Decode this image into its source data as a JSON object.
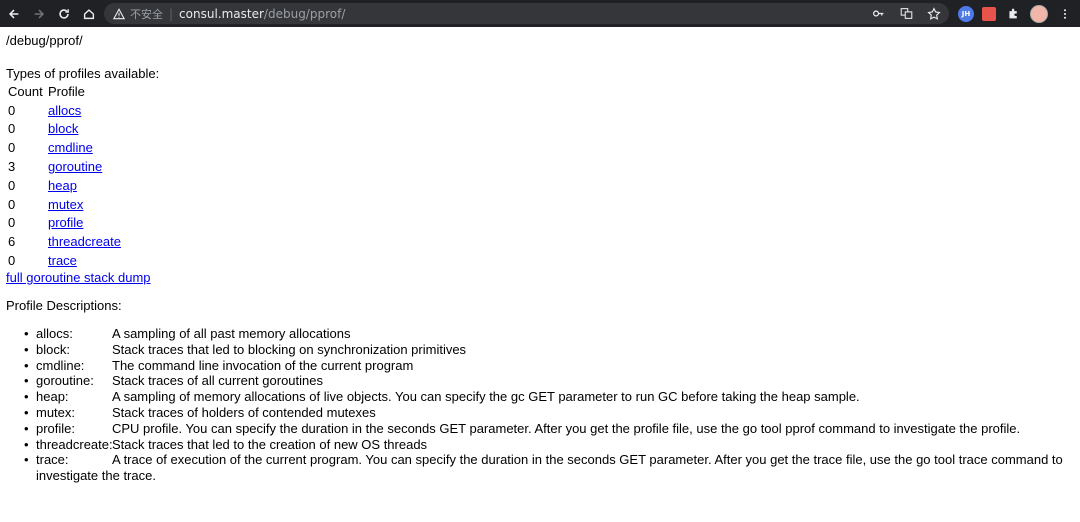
{
  "browser": {
    "insecure_label": "不安全",
    "url_host": "consul.master",
    "url_path": "/debug/pprof/",
    "profile_initials": "JH"
  },
  "page": {
    "path_heading": "/debug/pprof/",
    "types_heading": "Types of profiles available:",
    "table_headers": {
      "count": "Count",
      "profile": "Profile"
    },
    "profiles": [
      {
        "count": "0",
        "name": "allocs"
      },
      {
        "count": "0",
        "name": "block"
      },
      {
        "count": "0",
        "name": "cmdline"
      },
      {
        "count": "3",
        "name": "goroutine"
      },
      {
        "count": "0",
        "name": "heap"
      },
      {
        "count": "0",
        "name": "mutex"
      },
      {
        "count": "0",
        "name": "profile"
      },
      {
        "count": "6",
        "name": "threadcreate"
      },
      {
        "count": "0",
        "name": "trace"
      }
    ],
    "full_dump_link": "full goroutine stack dump",
    "descriptions_heading": "Profile Descriptions:",
    "descriptions": [
      {
        "name": "allocs:",
        "text": "A sampling of all past memory allocations"
      },
      {
        "name": "block:",
        "text": "Stack traces that led to blocking on synchronization primitives"
      },
      {
        "name": "cmdline:",
        "text": "The command line invocation of the current program"
      },
      {
        "name": "goroutine:",
        "text": "Stack traces of all current goroutines"
      },
      {
        "name": "heap:",
        "text": "A sampling of memory allocations of live objects. You can specify the gc GET parameter to run GC before taking the heap sample."
      },
      {
        "name": "mutex:",
        "text": "Stack traces of holders of contended mutexes"
      },
      {
        "name": "profile:",
        "text": "CPU profile. You can specify the duration in the seconds GET parameter. After you get the profile file, use the go tool pprof command to investigate the profile."
      },
      {
        "name": "threadcreate:",
        "text": "Stack traces that led to the creation of new OS threads"
      },
      {
        "name": "trace:",
        "text": "A trace of execution of the current program. You can specify the duration in the seconds GET parameter. After you get the trace file, use the go tool trace command to investigate the trace."
      }
    ]
  }
}
